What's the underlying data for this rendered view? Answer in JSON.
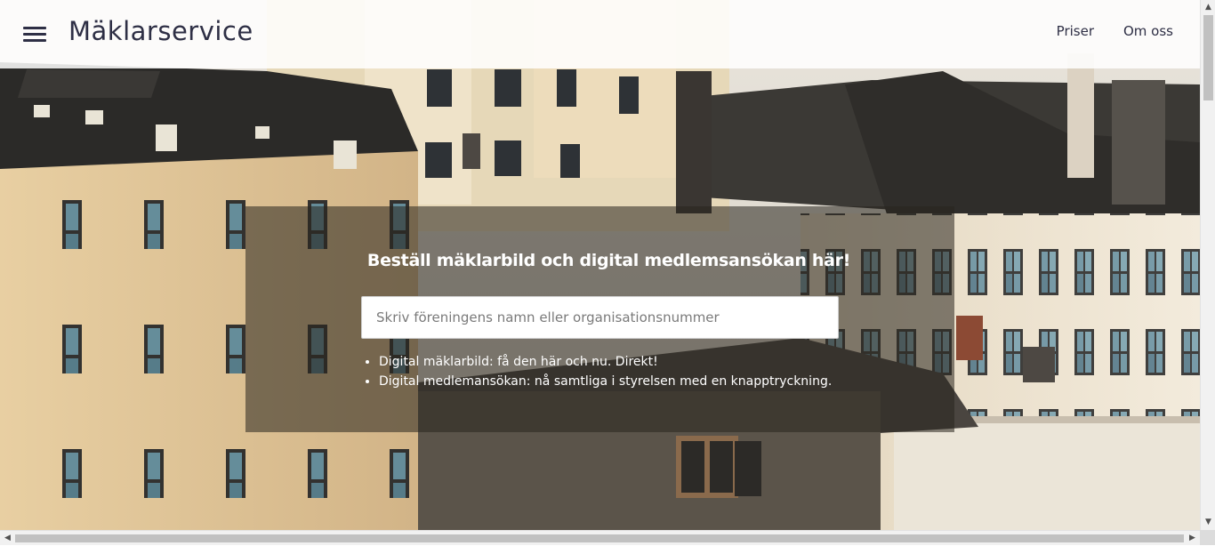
{
  "header": {
    "brand": "Mäklarservice",
    "nav": [
      {
        "label": "Priser"
      },
      {
        "label": "Om oss"
      }
    ]
  },
  "hero": {
    "title": "Beställ mäklarbild och digital medlemsansökan här!",
    "search": {
      "placeholder": "Skriv föreningens namn eller organisationsnummer",
      "value": ""
    },
    "features": [
      "Digital mäklarbild: få den här och nu. Direkt!",
      "Digital medlemansökan: nå samtliga i styrelsen med en knapptryckning."
    ]
  },
  "icons": {
    "menu": "hamburger-menu-icon",
    "scroll_up": "chevron-up-icon",
    "scroll_down": "chevron-down-icon",
    "scroll_left": "chevron-left-icon",
    "scroll_right": "chevron-right-icon"
  },
  "colors": {
    "brand_text": "#2e2f45",
    "header_bg": "#ffffffdc",
    "panel_bg": "#28241e8c"
  }
}
